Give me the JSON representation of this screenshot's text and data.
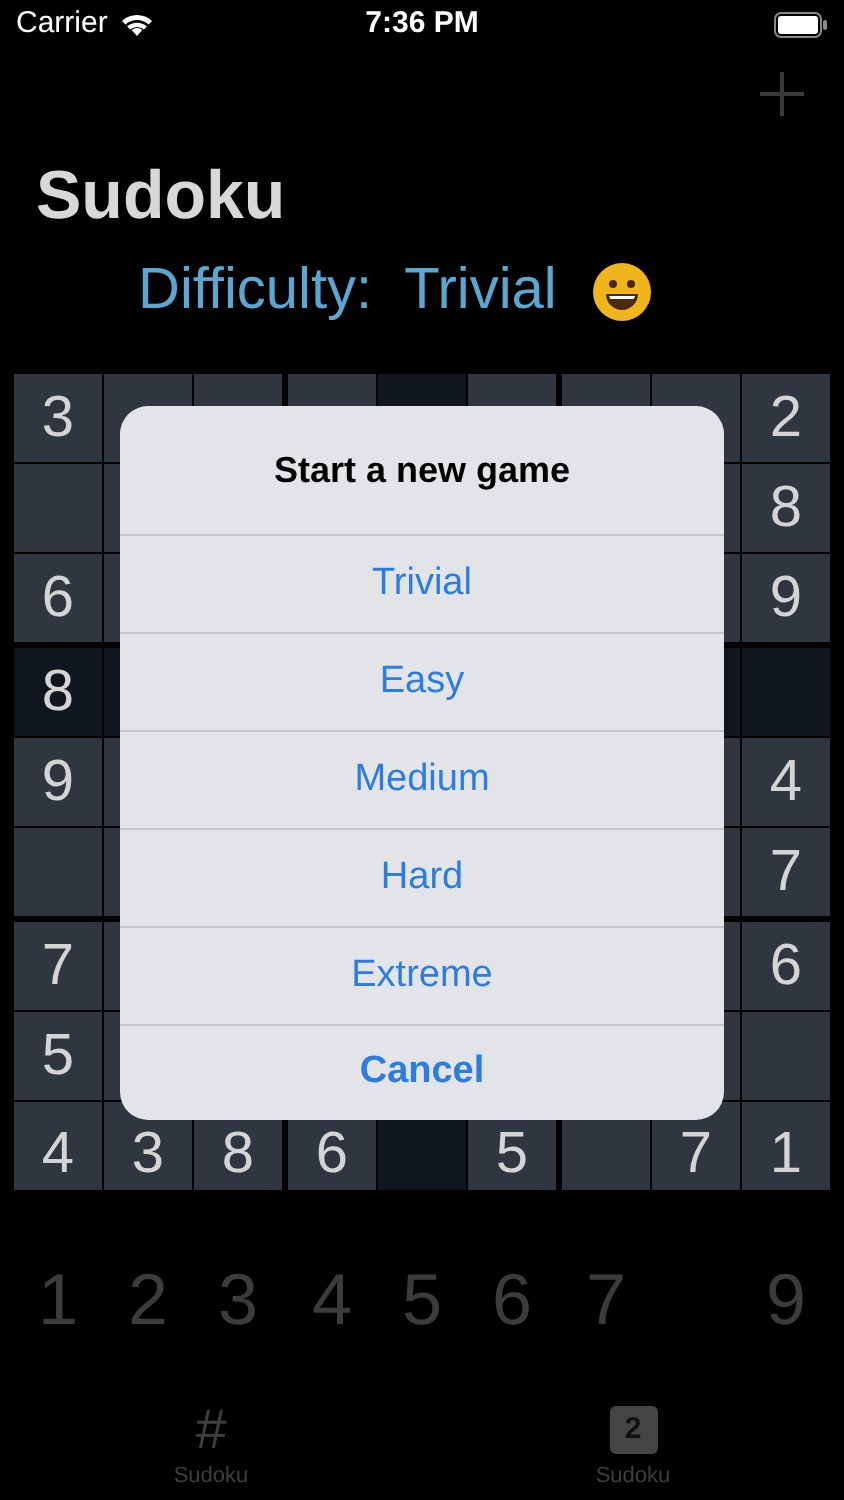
{
  "status_bar": {
    "carrier": "Carrier",
    "time": "7:36 PM"
  },
  "title": "Sudoku",
  "difficulty": {
    "label": "Difficulty:",
    "value": "Trivial"
  },
  "grid": {
    "left_column": [
      {
        "value": "3",
        "highlighted": false
      },
      {
        "highlighted": false
      },
      {
        "value": "6",
        "highlighted": false
      },
      {
        "value": "8",
        "highlighted": true
      },
      {
        "value": "9",
        "highlighted": false
      },
      {
        "highlighted": false
      },
      {
        "value": "7",
        "highlighted": false
      },
      {
        "value": "5",
        "highlighted": false
      }
    ],
    "right_column": [
      {
        "value": "2",
        "highlighted": false
      },
      {
        "value": "8",
        "highlighted": false
      },
      {
        "value": "9",
        "highlighted": false
      },
      {
        "highlighted": true
      },
      {
        "value": "4",
        "highlighted": false
      },
      {
        "value": "7",
        "highlighted": false
      },
      {
        "value": "6",
        "highlighted": false
      },
      {
        "highlighted": false
      }
    ],
    "bottom_row": [
      {
        "value": "4",
        "highlighted": false
      },
      {
        "value": "3",
        "highlighted": false
      },
      {
        "value": "8",
        "highlighted": false
      },
      {
        "value": "6",
        "highlighted": false
      },
      {
        "highlighted": true
      },
      {
        "value": "5",
        "highlighted": false
      },
      {
        "highlighted": false
      },
      {
        "value": "7",
        "highlighted": false
      },
      {
        "value": "1",
        "highlighted": false
      }
    ]
  },
  "dialog": {
    "title": "Start a new game",
    "options": [
      "Trivial",
      "Easy",
      "Medium",
      "Hard",
      "Extreme"
    ],
    "cancel": "Cancel"
  },
  "keypad": [
    {
      "kind": "digit",
      "digit": "1"
    },
    {
      "kind": "digit",
      "digit": "2"
    },
    {
      "kind": "digit",
      "digit": "3"
    },
    {
      "kind": "digit",
      "digit": "4"
    },
    {
      "kind": "digit",
      "digit": "5"
    },
    {
      "kind": "digit",
      "digit": "6"
    },
    {
      "kind": "digit",
      "digit": "7"
    },
    {
      "kind": "gap"
    },
    {
      "kind": "digit",
      "digit": "9"
    }
  ],
  "tab_bar": [
    {
      "kind": "glyph",
      "icon": "#",
      "label": "Sudoku"
    },
    {
      "kind": "badge",
      "icon": "2",
      "label": "Sudoku"
    }
  ]
}
